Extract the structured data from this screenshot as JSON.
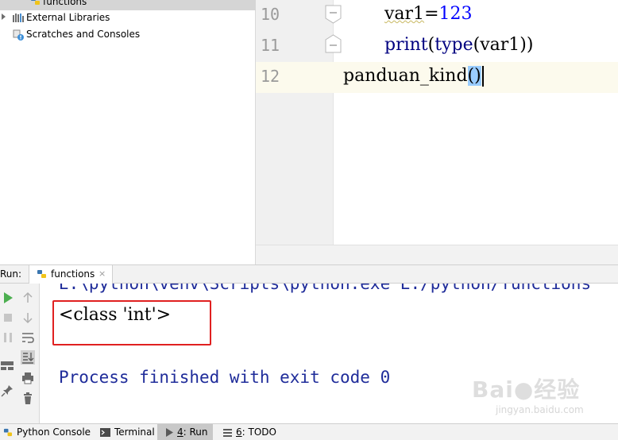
{
  "project_tree": {
    "items": [
      {
        "label": "functions",
        "selected": true,
        "icon": "python-file-icon"
      },
      {
        "label": "External Libraries",
        "icon": "library-icon"
      },
      {
        "label": "Scratches and Consoles",
        "icon": "scratches-icon"
      }
    ]
  },
  "editor": {
    "lines": [
      {
        "number": "10",
        "indent": "    ",
        "text": "var1=123"
      },
      {
        "number": "11",
        "indent": "    ",
        "text": "print(type(var1))"
      },
      {
        "number": "12",
        "indent": "",
        "text": "panduan_kind()"
      }
    ],
    "tokens": {
      "l10_name": "var1",
      "l10_eq": "=",
      "l10_num": "123",
      "l11_print": "print",
      "l11_open": "(",
      "l11_type": "type",
      "l11_inner": "(var1)",
      "l11_close": ")",
      "l12_name": "panduan_kind",
      "l12_parens": "()"
    }
  },
  "run_panel": {
    "label": "Run:",
    "tab": "functions",
    "close": "×",
    "console": {
      "command": "E:\\python\\venv\\Scripts\\python.exe E:/python/functions",
      "output": "<class 'int'>",
      "exit": "Process finished with exit code 0"
    }
  },
  "watermark": {
    "text": "Bai●经验",
    "url": "jingyan.baidu.com"
  },
  "bottom_bar": {
    "tabs": [
      {
        "label": "Python Console",
        "icon": "python-console-icon"
      },
      {
        "label": "Terminal",
        "icon": "terminal-icon"
      },
      {
        "label": "4: Run",
        "mnemonic": "4",
        "rest": ": Run",
        "icon": "run-icon",
        "active": true
      },
      {
        "label": "6: TODO",
        "mnemonic": "6",
        "rest": ": TODO",
        "icon": "todo-icon"
      }
    ]
  },
  "colors": {
    "keyword_blue": "#000080",
    "number_blue": "#0000ff",
    "console_blue": "#1f2c9a",
    "highlight_red": "#e02020",
    "run_green": "#4caf50"
  }
}
